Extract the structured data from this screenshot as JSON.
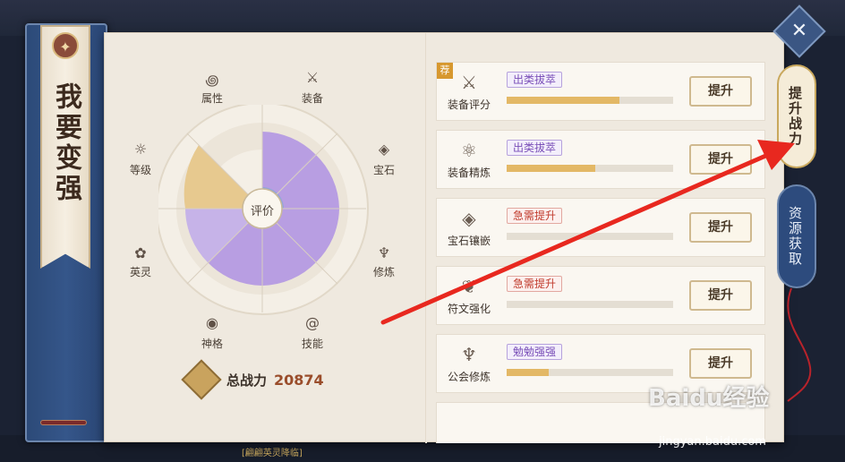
{
  "banner": {
    "title": "我要变强"
  },
  "radar": {
    "center_label": "评价",
    "stats": [
      {
        "label": "属性",
        "icon": "swirl-icon"
      },
      {
        "label": "装备",
        "icon": "crossed-swords-icon"
      },
      {
        "label": "宝石",
        "icon": "gem-icon"
      },
      {
        "label": "修炼",
        "icon": "mask-icon"
      },
      {
        "label": "技能",
        "icon": "spiral-icon"
      },
      {
        "label": "神格",
        "icon": "medallion-icon"
      },
      {
        "label": "英灵",
        "icon": "paw-icon"
      },
      {
        "label": "等级",
        "icon": "sun-icon"
      }
    ]
  },
  "power": {
    "label": "总战力",
    "value": "20874"
  },
  "rows": [
    {
      "name": "装备评分",
      "badge": "出类拔萃",
      "badge_type": "purple",
      "progress": 0.68,
      "button": "提升",
      "tag": "荐"
    },
    {
      "name": "装备精炼",
      "badge": "出类拔萃",
      "badge_type": "purple",
      "progress": 0.53,
      "button": "提升"
    },
    {
      "name": "宝石镶嵌",
      "badge": "急需提升",
      "badge_type": "red",
      "progress": 0.0,
      "button": "提升"
    },
    {
      "name": "符文强化",
      "badge": "急需提升",
      "badge_type": "red",
      "progress": 0.0,
      "button": "提升"
    },
    {
      "name": "公会修炼",
      "badge": "勉勉强强",
      "badge_type": "purple",
      "progress": 0.25,
      "button": "提升"
    }
  ],
  "tabs": {
    "active": "提升战力",
    "inactive": "资源获取"
  },
  "close": "✕",
  "bottom_tip": "[翩翩英灵降临]",
  "watermark": {
    "main": "Baidu经验",
    "sub": "jingyan.baidu.com"
  }
}
